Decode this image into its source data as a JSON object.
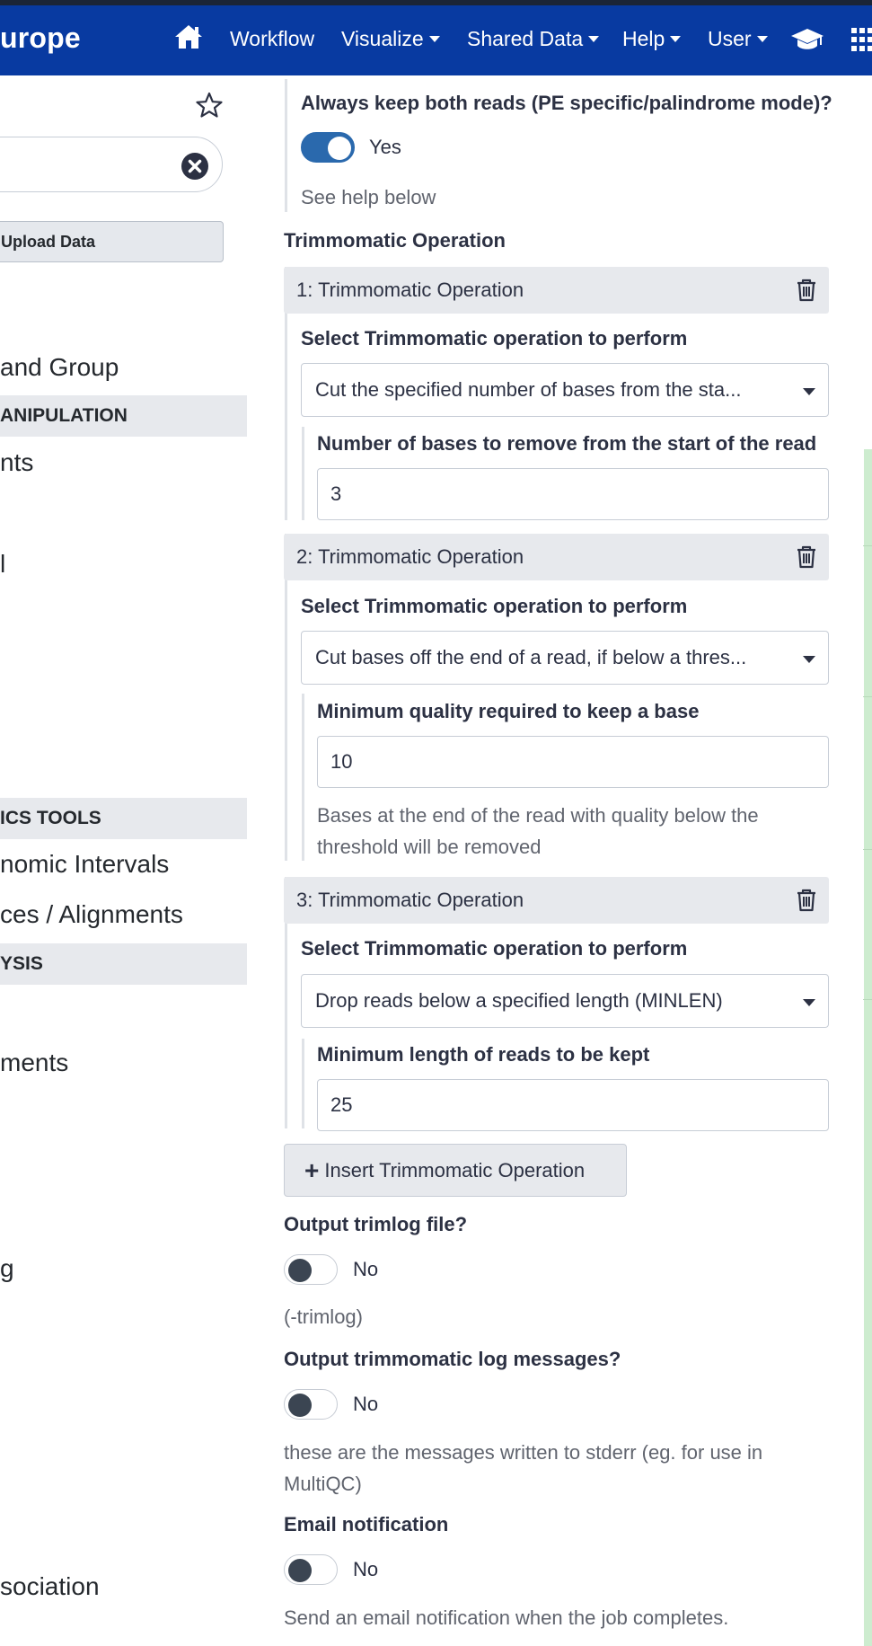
{
  "navbar": {
    "brand": "urope",
    "items": [
      "Workflow",
      "Visualize",
      "Shared Data",
      "Help",
      "User"
    ],
    "icons": [
      "home-icon",
      "graduation-cap-icon",
      "grid-icon"
    ]
  },
  "sidebar": {
    "upload_label": "Upload Data",
    "items": [
      {
        "type": "item",
        "label": "and Group"
      },
      {
        "type": "section",
        "label": "ANIPULATION"
      },
      {
        "type": "item",
        "label": "nts"
      },
      {
        "type": "item",
        "label": "l"
      },
      {
        "type": "section",
        "label": "ICS TOOLS"
      },
      {
        "type": "item",
        "label": "nomic Intervals"
      },
      {
        "type": "item",
        "label": "ces / Alignments"
      },
      {
        "type": "section",
        "label": "YSIS"
      },
      {
        "type": "item",
        "label": "ments"
      },
      {
        "type": "item",
        "label": "g"
      },
      {
        "type": "item",
        "label": "sociation"
      }
    ]
  },
  "form": {
    "keep_both": {
      "label": "Always keep both reads (PE specific/palindrome mode)?",
      "value": "Yes",
      "on": true,
      "help": "See help below"
    },
    "operations_title": "Trimmomatic Operation",
    "operations": [
      {
        "title": "1: Trimmomatic Operation",
        "select_label": "Select Trimmomatic operation to perform",
        "select_value": "Cut the specified number of bases from the sta...",
        "param_label": "Number of bases to remove from the start of the read",
        "param_value": "3",
        "param_help": ""
      },
      {
        "title": "2: Trimmomatic Operation",
        "select_label": "Select Trimmomatic operation to perform",
        "select_value": "Cut bases off the end of a read, if below a thres...",
        "param_label": "Minimum quality required to keep a base",
        "param_value": "10",
        "param_help": "Bases at the end of the read with quality below the threshold will be removed"
      },
      {
        "title": "3: Trimmomatic Operation",
        "select_label": "Select Trimmomatic operation to perform",
        "select_value": "Drop reads below a specified length (MINLEN)",
        "param_label": "Minimum length of reads to be kept",
        "param_value": "25",
        "param_help": ""
      }
    ],
    "insert_label": "Insert Trimmomatic Operation",
    "trimlog": {
      "label": "Output trimlog file?",
      "value": "No",
      "on": false,
      "help": "(-trimlog)"
    },
    "log_messages": {
      "label": "Output trimmomatic log messages?",
      "value": "No",
      "on": false,
      "help": "these are the messages written to stderr (eg. for use in MultiQC)"
    },
    "email": {
      "label": "Email notification",
      "value": "No",
      "on": false,
      "help": "Send an email notification when the job completes."
    }
  },
  "colors": {
    "navbar": "#083aa1",
    "toggle_on": "#2a69ad",
    "panel": "#e7e9ed"
  }
}
